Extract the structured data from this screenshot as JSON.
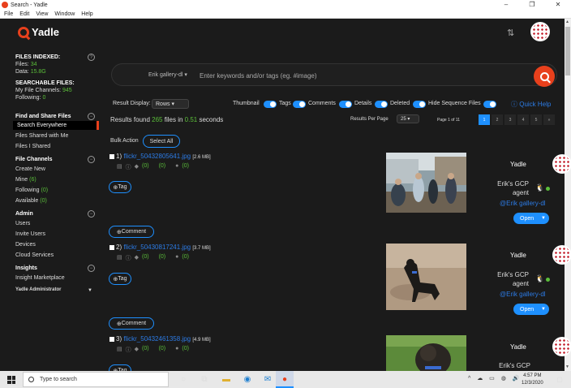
{
  "window": {
    "title": "Search - Yadle",
    "controls": [
      "–",
      "❐",
      "✕"
    ]
  },
  "menu": [
    "File",
    "Edit",
    "View",
    "Window",
    "Help"
  ],
  "header": {
    "logo_text": "Yadle"
  },
  "sidebar": {
    "files_indexed": {
      "heading": "FILES INDEXED:",
      "files_label": "Files:",
      "files_value": "34",
      "data_label": "Data:",
      "data_value": "15.8G"
    },
    "searchable": {
      "heading": "SEARCHABLE FILES:",
      "channels_label": "My File Channels:",
      "channels_value": "945",
      "following_label": "Following:",
      "following_value": "0"
    },
    "find_share": {
      "heading": "Find and Share Files",
      "items": [
        "Search Everywhere",
        "Files Shared with Me",
        "Files I Shared"
      ]
    },
    "file_channels": {
      "heading": "File Channels",
      "create": "Create New",
      "mine_label": "Mine",
      "mine_value": "(6)",
      "following_label": "Following",
      "following_value": "(0)",
      "available_label": "Available",
      "available_value": "(0)"
    },
    "admin": {
      "heading": "Admin",
      "items": [
        "Users",
        "Invite Users",
        "Devices",
        "Cloud Services"
      ]
    },
    "insights": {
      "heading": "Insights",
      "items": [
        "Insight Marketplace"
      ]
    },
    "account": "Yadle Administrator"
  },
  "search": {
    "scope": "Erik gallery-dl",
    "placeholder": "Enter keywords and/or tags (eg. #image)"
  },
  "options": {
    "result_display_label": "Result Display:",
    "result_display_value": "Rows",
    "toggles": [
      "Thumbnail",
      "Tags",
      "Comments",
      "Details",
      "Deleted",
      "Hide Sequence Files"
    ],
    "quick_help": "Quick Help"
  },
  "results": {
    "prefix": "Results found",
    "count": "265",
    "mid": "files in",
    "time": "0.51",
    "suffix": "seconds",
    "per_page_label": "Results Per Page",
    "per_page_value": "25",
    "page_of": "Page 1 of 11",
    "pages": [
      "1",
      "2",
      "3",
      "4",
      "5",
      "»"
    ]
  },
  "bulk": {
    "label": "Bulk Action",
    "select_all": "Select All"
  },
  "rows": [
    {
      "index": "1)",
      "name": "flickr_50432805641.jpg",
      "size": "[2.6 MB]",
      "counts": [
        "(0)",
        "(0)",
        "(0)"
      ],
      "tag": "Tag",
      "comment": "Comment",
      "owner": "Yadle",
      "agent": "Erik's GCP agent",
      "agent_link": "@Erik gallery-dl",
      "open": "Open"
    },
    {
      "index": "2)",
      "name": "flickr_50430817241.jpg",
      "size": "[3.7 MB]",
      "counts": [
        "(0)",
        "(0)",
        "(0)"
      ],
      "tag": "Tag",
      "comment": "Comment",
      "owner": "Yadle",
      "agent": "Erik's GCP agent",
      "agent_link": "@Erik gallery-dl",
      "open": "Open"
    },
    {
      "index": "3)",
      "name": "flickr_50432461358.jpg",
      "size": "[4.9 MB]",
      "counts": [
        "(0)",
        "(0)",
        "(0)"
      ],
      "tag": "Tag",
      "owner": "Yadle",
      "agent": "Erik's GCP"
    }
  ],
  "taskbar": {
    "search_placeholder": "Type to search",
    "time": "4:57 PM",
    "date": "12/3/2020"
  }
}
